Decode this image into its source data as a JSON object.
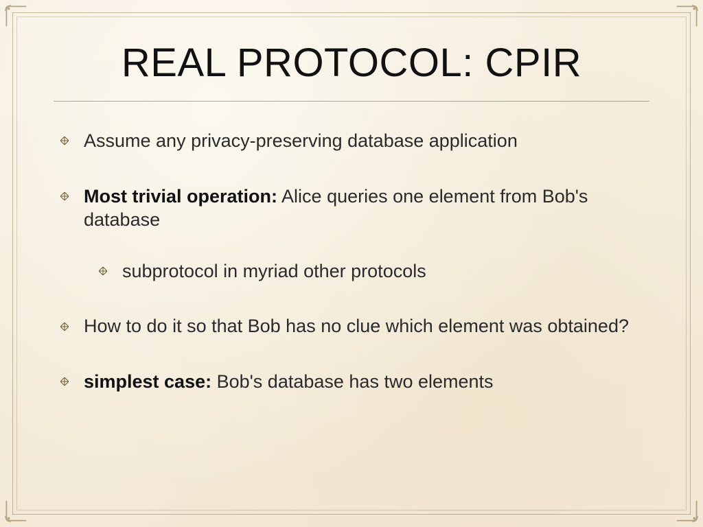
{
  "title": "REAL PROTOCOL: CPIR",
  "bullets": {
    "b1": "Assume any privacy-preserving database application",
    "b2_bold": "Most trivial operation:",
    "b2_rest": " Alice queries one element from Bob's database",
    "b2_sub1": "subprotocol in myriad other protocols",
    "b3": "How to do it so that Bob has no clue which element was obtained?",
    "b4_bold": "simplest case:",
    "b4_rest": " Bob's database has two elements"
  }
}
